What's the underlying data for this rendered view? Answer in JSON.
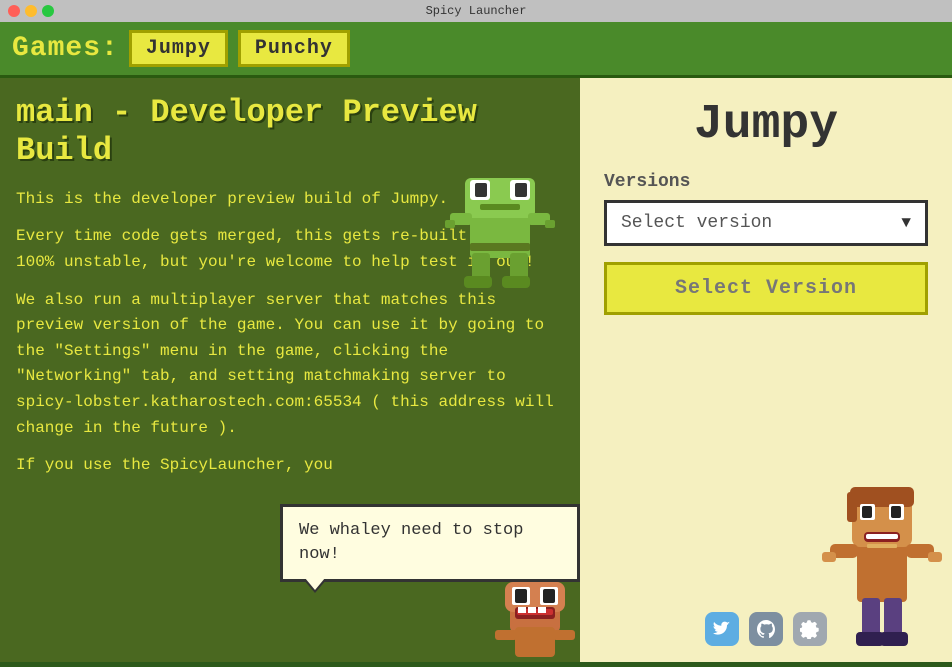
{
  "titlebar": {
    "title": "Spicy Launcher",
    "traffic_lights": [
      "red",
      "yellow",
      "green"
    ]
  },
  "games_bar": {
    "label": "Games:",
    "tabs": [
      {
        "id": "jumpy",
        "label": "Jumpy",
        "active": true
      },
      {
        "id": "punchy",
        "label": "Punchy",
        "active": false
      }
    ]
  },
  "left_panel": {
    "build_title": "main - Developer Preview Build",
    "description_p1": "This is the developer preview build of Jumpy.",
    "description_p2": "Every time code gets merged, this gets re-built. It's 100% unstable, but you're welcome to help test it out!",
    "description_p3": "We also run a multiplayer server that matches this preview version of the game. You can use it by going to the \"Settings\" menu in the game, clicking the \"Networking\" tab, and setting matchmaking server to spicy-lobster.katharostech.com:65534 ( this address will change in the future ).",
    "description_p4": "If you use the SpicyLauncher, you",
    "speech_bubble": "We whaley need to stop now!"
  },
  "right_panel": {
    "game_title": "Jumpy",
    "versions_label": "Versions",
    "version_dropdown_placeholder": "Select version",
    "select_version_button": "Select Version"
  },
  "social_icons": {
    "twitter": "Twitter",
    "github": "GitHub",
    "settings": "Settings"
  },
  "colors": {
    "background": "#4a6820",
    "accent_yellow": "#e8e840",
    "right_panel_bg": "#f5f0c0",
    "games_bar_bg": "#4a8a2a"
  }
}
